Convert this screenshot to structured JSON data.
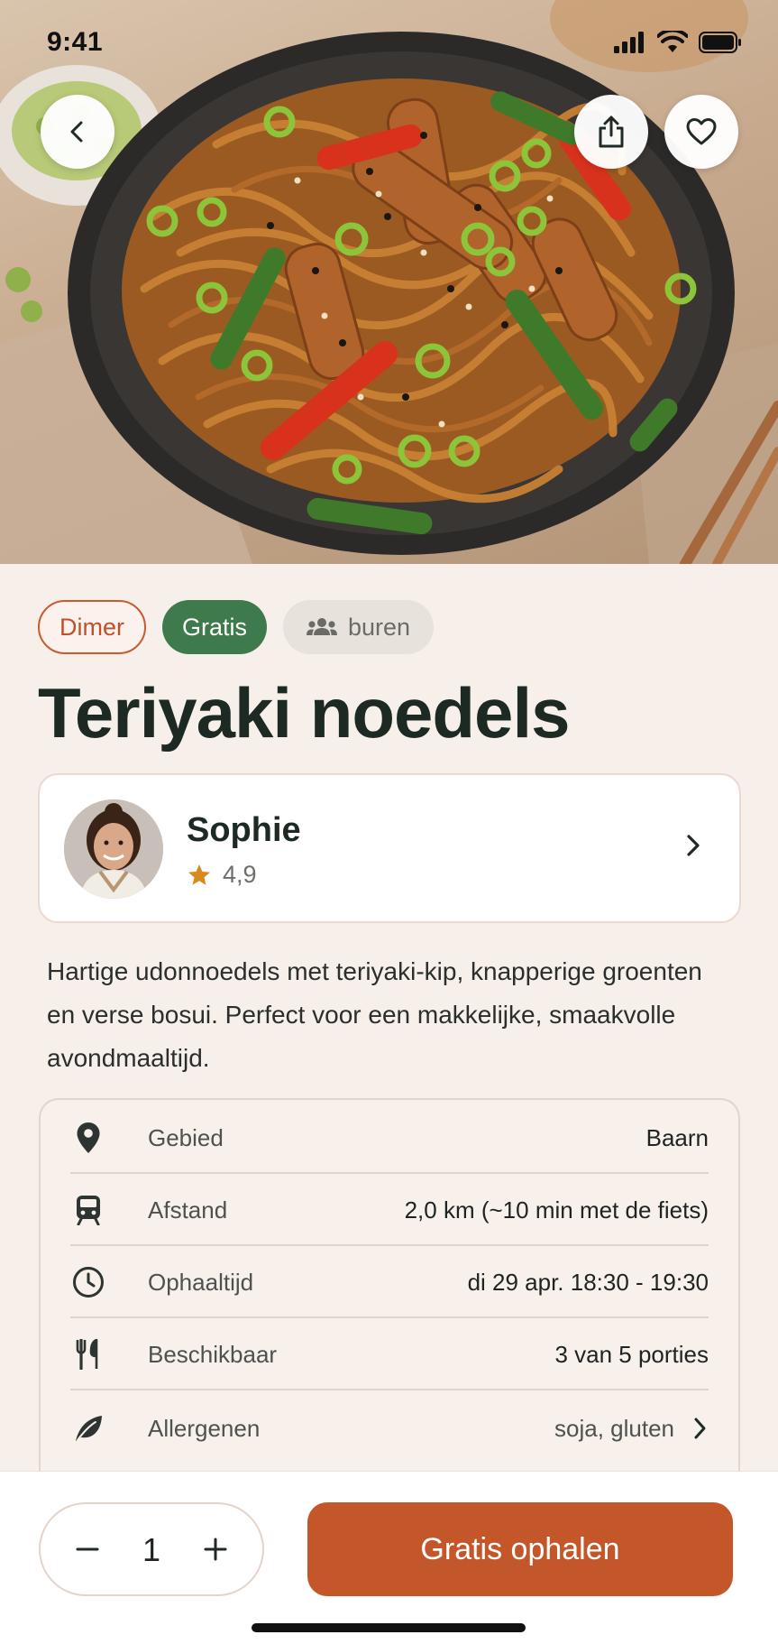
{
  "status_bar": {
    "time": "9:41",
    "icons": [
      "signal-icon",
      "wifi-icon",
      "battery-icon"
    ]
  },
  "hero": {
    "image": "teriyaki-udon-noodles-photo",
    "buttons": [
      "back-icon",
      "share-icon",
      "heart-icon"
    ]
  },
  "tags": {
    "meal_type": "Dimer",
    "price": "Gratis",
    "audience": "buren",
    "audience_icon": "group-icon"
  },
  "title": "Teriyaki noedels",
  "cook": {
    "name": "Sophie",
    "rating": "4,9",
    "rating_icon": "star-icon"
  },
  "description": "Hartige udonnoedels met teriyaki-kip, knapperige groenten en verse bosui. Perfect voor een makkelijke, smaakvolle avondmaaltijd.",
  "details": [
    {
      "icon": "location-pin-icon",
      "label": "Gebied",
      "value": "Baarn"
    },
    {
      "icon": "train-icon",
      "label": "Afstand",
      "value": "2,0 km (~10 min met de fiets)"
    },
    {
      "icon": "clock-icon",
      "label": "Ophaaltijd",
      "value": "di 29 apr. 18:30 - 19:30"
    },
    {
      "icon": "cutlery-icon",
      "label": "Beschikbaar",
      "value": "3 van 5 porties"
    },
    {
      "icon": "leaf-icon",
      "label": "Allergenen",
      "value": "soja, gluten"
    }
  ],
  "order": {
    "quantity": "1",
    "cta_label": "Gratis ophalen"
  },
  "colors": {
    "background": "#f7efe9",
    "accent": "#c4572a",
    "green": "#3e7a4c",
    "star": "#d98a1f"
  }
}
